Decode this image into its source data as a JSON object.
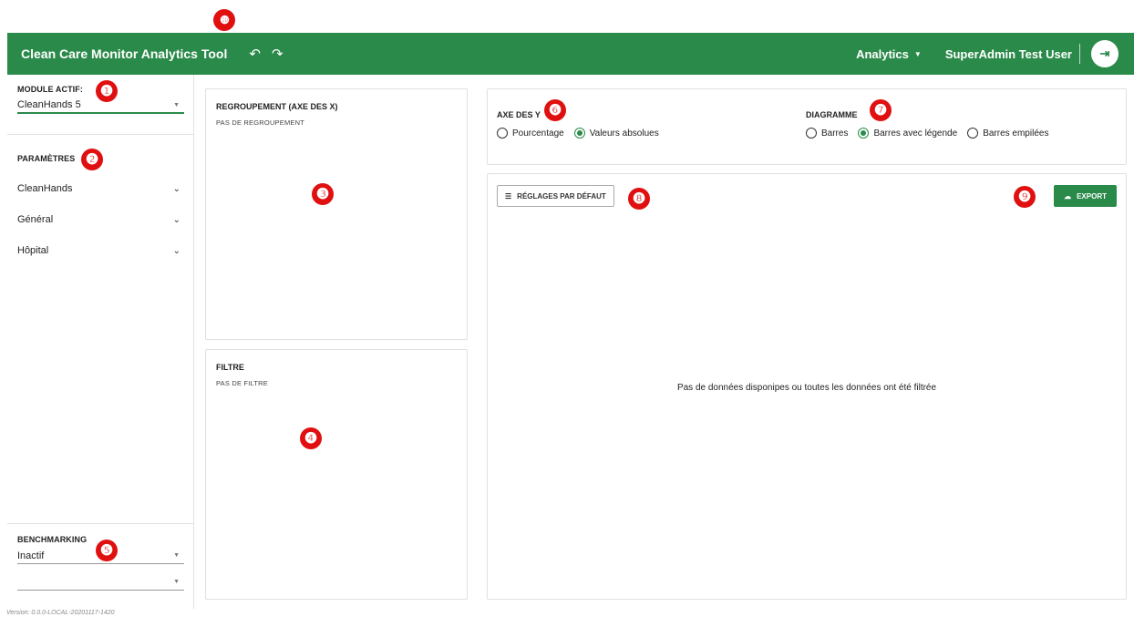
{
  "header": {
    "title": "Clean Care Monitor Analytics Tool",
    "undo_icon": "undo-icon",
    "redo_icon": "redo-icon",
    "analytics_menu": "Analytics",
    "user_name": "SuperAdmin Test User",
    "logout_icon": "logout-icon"
  },
  "sidebar": {
    "module_label": "MODULE ACTIF:",
    "module_value": "CleanHands 5",
    "params_label": "PARAMÈTRES",
    "param_items": [
      "CleanHands",
      "Général",
      "Hôpital"
    ],
    "benchmarking_label": "BENCHMARKING",
    "benchmarking_value": "Inactif",
    "benchmarking_second_value": ""
  },
  "grouping": {
    "title": "REGROUPEMENT (AXE DES X)",
    "subtitle": "PAS DE REGROUPEMENT"
  },
  "filter": {
    "title": "FILTRE",
    "subtitle": "PAS DE FILTRE"
  },
  "y_axis": {
    "title": "AXE DES Y",
    "options": [
      {
        "label": "Pourcentage",
        "checked": false
      },
      {
        "label": "Valeurs absolues",
        "checked": true
      }
    ]
  },
  "diagram": {
    "title": "DIAGRAMME",
    "options": [
      {
        "label": "Barres",
        "checked": false
      },
      {
        "label": "Barres avec légende",
        "checked": true
      },
      {
        "label": "Barres empilées",
        "checked": false
      }
    ]
  },
  "chart_area": {
    "defaults_button": "RÉGLAGES PAR DÉFAUT",
    "export_button": "EXPORT",
    "empty_message": "Pas de données disponipes ou toutes les données ont été filtrée"
  },
  "markers": [
    "❶",
    "❷",
    "❸",
    "❹",
    "❺",
    "❻",
    "❼",
    "❽",
    "❾",
    "❿"
  ],
  "footer": {
    "version": "Version: 0.0.0-LOCAL-20201117-1420"
  },
  "colors": {
    "brand_green": "#2a8a4a",
    "marker_red": "#e01010"
  }
}
